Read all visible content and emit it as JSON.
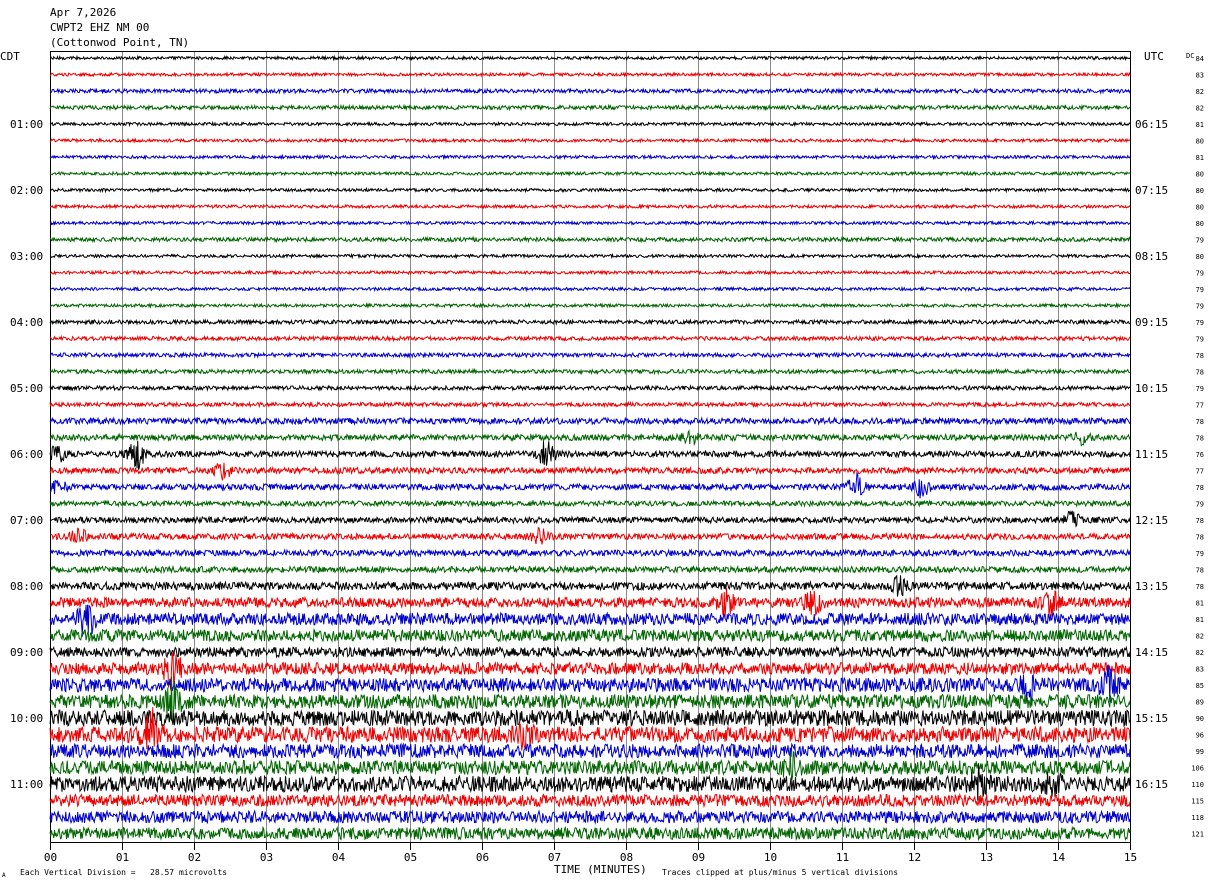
{
  "header": {
    "date": "Apr 7,2026",
    "station": "CWPT2 EHZ NM 00",
    "location": "(Cottonwod Point, TN)"
  },
  "left_tz": "CDT",
  "right_tz": "UTC",
  "dc_label": "DC",
  "footer": {
    "scale_note": "Each Vertical Division =   28.57 microvolts",
    "xlabel": "TIME (MINUTES)",
    "clip_note": "Traces clipped at plus/minus 5 vertical divisions",
    "corner_mark": "A"
  },
  "chart_data": {
    "type": "line",
    "title": "",
    "xlabel": "TIME (MINUTES)",
    "xlim": [
      0,
      15
    ],
    "x_ticks": [
      "00",
      "01",
      "02",
      "03",
      "04",
      "05",
      "06",
      "07",
      "08",
      "09",
      "10",
      "11",
      "12",
      "13",
      "14",
      "15"
    ],
    "trace_colors": [
      "#000000",
      "#ee0000",
      "#0000cc",
      "#006600"
    ],
    "row_count": 48,
    "left_time_labels": [
      {
        "row": 4,
        "text": "01:00"
      },
      {
        "row": 8,
        "text": "02:00"
      },
      {
        "row": 12,
        "text": "03:00"
      },
      {
        "row": 16,
        "text": "04:00"
      },
      {
        "row": 20,
        "text": "05:00"
      },
      {
        "row": 24,
        "text": "06:00"
      },
      {
        "row": 28,
        "text": "07:00"
      },
      {
        "row": 32,
        "text": "08:00"
      },
      {
        "row": 36,
        "text": "09:00"
      },
      {
        "row": 40,
        "text": "10:00"
      },
      {
        "row": 44,
        "text": "11:00"
      }
    ],
    "right_time_labels": [
      {
        "row": 4,
        "text": "06:15"
      },
      {
        "row": 8,
        "text": "07:15"
      },
      {
        "row": 12,
        "text": "08:15"
      },
      {
        "row": 16,
        "text": "09:15"
      },
      {
        "row": 20,
        "text": "10:15"
      },
      {
        "row": 24,
        "text": "11:15"
      },
      {
        "row": 28,
        "text": "12:15"
      },
      {
        "row": 32,
        "text": "13:15"
      },
      {
        "row": 36,
        "text": "14:15"
      },
      {
        "row": 40,
        "text": "15:15"
      },
      {
        "row": 44,
        "text": "16:15"
      }
    ],
    "dc_values": [
      "84",
      "83",
      "82",
      "82",
      "81",
      "80",
      "81",
      "80",
      "80",
      "80",
      "80",
      "79",
      "80",
      "79",
      "79",
      "79",
      "79",
      "79",
      "78",
      "78",
      "79",
      "77",
      "78",
      "78",
      "76",
      "77",
      "78",
      "79",
      "78",
      "78",
      "79",
      "78",
      "78",
      "81",
      "81",
      "82",
      "82",
      "83",
      "85",
      "89",
      "90",
      "96",
      "99",
      "106",
      "110",
      "115",
      "118",
      "121"
    ],
    "noise_levels": [
      1.5,
      1.5,
      2,
      2,
      1.5,
      1.5,
      1.5,
      1.5,
      1.5,
      1.5,
      1.5,
      2,
      1.5,
      1.5,
      1.5,
      1.5,
      2,
      2,
      2,
      2,
      2,
      2,
      3,
      3,
      3,
      3,
      3,
      2.5,
      3,
      3,
      3,
      3,
      4,
      5,
      6,
      6,
      5,
      6,
      7,
      7,
      8,
      8,
      7,
      7,
      8,
      6,
      6,
      6
    ],
    "events": [
      {
        "row": 23,
        "minute": 8.9,
        "amp": 5
      },
      {
        "row": 23,
        "minute": 14.3,
        "amp": 6
      },
      {
        "row": 24,
        "minute": 0.1,
        "amp": 8
      },
      {
        "row": 24,
        "minute": 1.2,
        "amp": 14
      },
      {
        "row": 24,
        "minute": 6.9,
        "amp": 12
      },
      {
        "row": 25,
        "minute": 2.4,
        "amp": 7
      },
      {
        "row": 26,
        "minute": 0.1,
        "amp": 7
      },
      {
        "row": 26,
        "minute": 11.2,
        "amp": 12
      },
      {
        "row": 26,
        "minute": 12.1,
        "amp": 9
      },
      {
        "row": 28,
        "minute": 14.2,
        "amp": 7
      },
      {
        "row": 29,
        "minute": 0.4,
        "amp": 7
      },
      {
        "row": 29,
        "minute": 6.8,
        "amp": 7
      },
      {
        "row": 32,
        "minute": 11.8,
        "amp": 8
      },
      {
        "row": 33,
        "minute": 9.4,
        "amp": 12
      },
      {
        "row": 33,
        "minute": 10.6,
        "amp": 10
      },
      {
        "row": 33,
        "minute": 13.9,
        "amp": 11
      },
      {
        "row": 34,
        "minute": 0.5,
        "amp": 16
      },
      {
        "row": 37,
        "minute": 1.7,
        "amp": 18
      },
      {
        "row": 38,
        "minute": 13.6,
        "amp": 16
      },
      {
        "row": 38,
        "minute": 14.7,
        "amp": 13
      },
      {
        "row": 39,
        "minute": 1.7,
        "amp": 18
      },
      {
        "row": 41,
        "minute": 1.4,
        "amp": 22
      },
      {
        "row": 41,
        "minute": 6.6,
        "amp": 10
      },
      {
        "row": 43,
        "minute": 10.3,
        "amp": 12
      },
      {
        "row": 44,
        "minute": 12.9,
        "amp": 12
      },
      {
        "row": 44,
        "minute": 13.9,
        "amp": 11
      }
    ]
  }
}
